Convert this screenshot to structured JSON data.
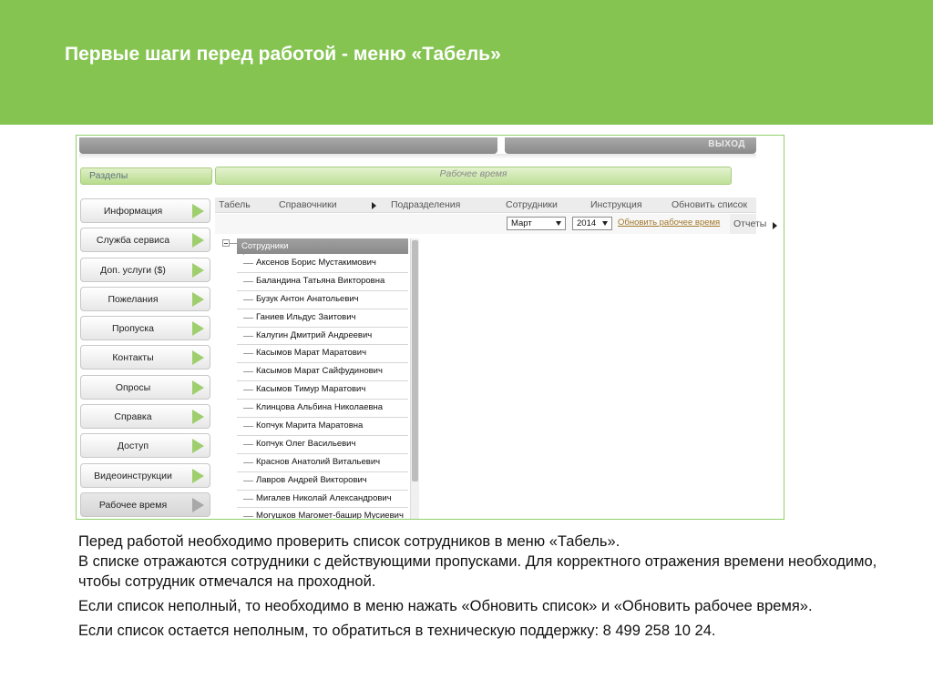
{
  "slide": {
    "title": "Первые шаги перед работой - меню «Табель»",
    "caption": [
      "Перед работой необходимо проверить список сотрудников в меню «Табель».",
      "В списке отражаются сотрудники с действующими пропусками. Для корректного отражения времени необходимо, чтобы сотрудник отмечался на проходной.",
      "Если список неполный, то необходимо в меню нажать «Обновить список» и «Обновить рабочее время».",
      "Если список остается неполным, то обратиться в техническую поддержку: 8 499 258 10 24."
    ]
  },
  "app": {
    "exit_label": "ВЫХОД",
    "sections_label": "Разделы",
    "page_heading": "Рабочее время",
    "sidebar": {
      "items": [
        {
          "label": "Информация"
        },
        {
          "label": "Служба сервиса"
        },
        {
          "label": "Доп. услуги ($)"
        },
        {
          "label": "Пожелания"
        },
        {
          "label": "Пропуска"
        },
        {
          "label": "Контакты"
        },
        {
          "label": "Опросы"
        },
        {
          "label": "Справка"
        },
        {
          "label": "Доступ"
        },
        {
          "label": "Видеоинструкции"
        },
        {
          "label": "Рабочее время"
        }
      ],
      "active_index": 10
    },
    "menubar": {
      "items": [
        "Табель",
        "Справочники",
        "Подразделения",
        "Сотрудники",
        "Инструкция",
        "Обновить список"
      ]
    },
    "toolbar": {
      "month": "Март",
      "year": "2014",
      "update_link": "Обновить рабочее время",
      "reports": "Отчеты"
    },
    "employees": {
      "header": "Сотрудники",
      "list": [
        "Аксенов Борис Мустакимович",
        "Баландина Татьяна Викторовна",
        "Бузук Антон Анатольевич",
        "Ганиев Ильдус Заитович",
        "Калугин Дмитрий Андреевич",
        "Касымов Марат Маратович",
        "Касымов Марат Сайфудинович",
        "Касымов Тимур Маратович",
        "Клинцова Альбина Николаевна",
        "Копчук Марита Маратовна",
        "Копчук Олег Васильевич",
        "Краснов Анатолий Витальевич",
        "Лавров Андрей Викторович",
        "Мигалев Николай Александрович",
        "Могушков Магомет-башир Мусиевич"
      ]
    }
  }
}
